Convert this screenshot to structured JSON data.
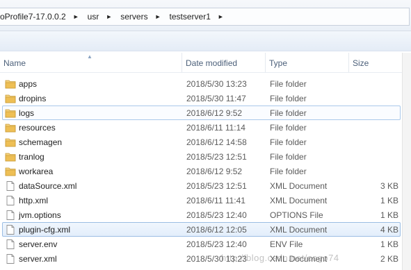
{
  "address": {
    "crumbs": [
      "oProfile7-17.0.0.2",
      "usr",
      "servers",
      "testserver1"
    ]
  },
  "columns": {
    "name": "Name",
    "date": "Date modified",
    "type": "Type",
    "size": "Size"
  },
  "files": [
    {
      "name": "apps",
      "date": "2018/5/30 13:23",
      "type": "File folder",
      "size": "",
      "icon": "folder-icon"
    },
    {
      "name": "dropins",
      "date": "2018/5/30 11:47",
      "type": "File folder",
      "size": "",
      "icon": "folder-icon"
    },
    {
      "name": "logs",
      "date": "2018/6/12 9:52",
      "type": "File folder",
      "size": "",
      "icon": "folder-icon"
    },
    {
      "name": "resources",
      "date": "2018/6/11 11:14",
      "type": "File folder",
      "size": "",
      "icon": "folder-icon"
    },
    {
      "name": "schemagen",
      "date": "2018/6/12 14:58",
      "type": "File folder",
      "size": "",
      "icon": "folder-icon"
    },
    {
      "name": "tranlog",
      "date": "2018/5/23 12:51",
      "type": "File folder",
      "size": "",
      "icon": "folder-icon"
    },
    {
      "name": "workarea",
      "date": "2018/6/12 9:52",
      "type": "File folder",
      "size": "",
      "icon": "folder-icon"
    },
    {
      "name": "dataSource.xml",
      "date": "2018/5/23 12:51",
      "type": "XML Document",
      "size": "3 KB",
      "icon": "file-icon"
    },
    {
      "name": "http.xml",
      "date": "2018/6/11 11:41",
      "type": "XML Document",
      "size": "1 KB",
      "icon": "file-icon"
    },
    {
      "name": "jvm.options",
      "date": "2018/5/23 12:40",
      "type": "OPTIONS File",
      "size": "1 KB",
      "icon": "file-icon"
    },
    {
      "name": "plugin-cfg.xml",
      "date": "2018/6/12 12:05",
      "type": "XML Document",
      "size": "4 KB",
      "icon": "file-icon"
    },
    {
      "name": "server.env",
      "date": "2018/5/23 12:40",
      "type": "ENV File",
      "size": "1 KB",
      "icon": "file-icon"
    },
    {
      "name": "server.xml",
      "date": "2018/5/30 13:23",
      "type": "XML Document",
      "size": "2 KB",
      "icon": "file-icon"
    }
  ],
  "watermark": "http://blog.csdn.net/cogo74",
  "colors": {
    "folder": "#e8b64a",
    "selection_border": "#9bbde3",
    "header_text": "#4c607a"
  }
}
